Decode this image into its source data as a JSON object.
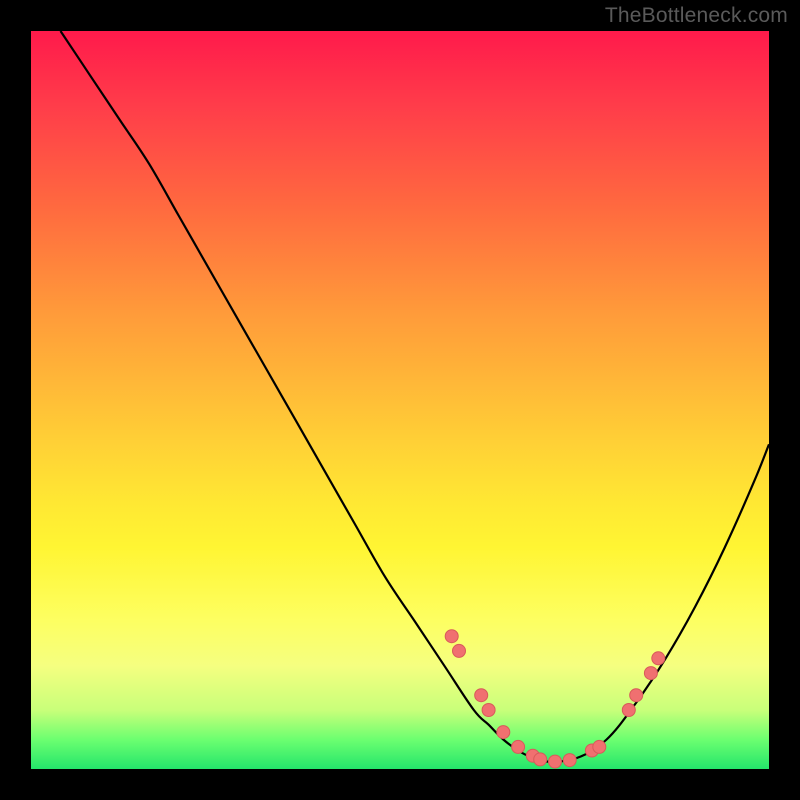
{
  "watermark": "TheBottleneck.com",
  "colors": {
    "frame": "#000000",
    "curve": "#000000",
    "dot_fill": "#f07070",
    "dot_stroke": "#d85a5a"
  },
  "chart_data": {
    "type": "line",
    "title": "",
    "xlabel": "",
    "ylabel": "",
    "xlim": [
      0,
      100
    ],
    "ylim": [
      0,
      100
    ],
    "series": [
      {
        "name": "curve",
        "x": [
          4,
          8,
          12,
          16,
          20,
          24,
          28,
          32,
          36,
          40,
          44,
          48,
          52,
          56,
          60,
          62,
          64,
          66,
          68,
          70,
          74,
          78,
          82,
          86,
          90,
          94,
          98,
          100
        ],
        "y": [
          100,
          94,
          88,
          82,
          75,
          68,
          61,
          54,
          47,
          40,
          33,
          26,
          20,
          14,
          8,
          6,
          4,
          2.5,
          1.5,
          1,
          1.5,
          4,
          9,
          15,
          22,
          30,
          39,
          44
        ]
      }
    ],
    "dots": [
      {
        "x": 57,
        "y": 18
      },
      {
        "x": 58,
        "y": 16
      },
      {
        "x": 61,
        "y": 10
      },
      {
        "x": 62,
        "y": 8
      },
      {
        "x": 64,
        "y": 5
      },
      {
        "x": 66,
        "y": 3
      },
      {
        "x": 68,
        "y": 1.8
      },
      {
        "x": 69,
        "y": 1.3
      },
      {
        "x": 71,
        "y": 1
      },
      {
        "x": 73,
        "y": 1.2
      },
      {
        "x": 76,
        "y": 2.5
      },
      {
        "x": 77,
        "y": 3
      },
      {
        "x": 81,
        "y": 8
      },
      {
        "x": 82,
        "y": 10
      },
      {
        "x": 84,
        "y": 13
      },
      {
        "x": 85,
        "y": 15
      }
    ]
  }
}
